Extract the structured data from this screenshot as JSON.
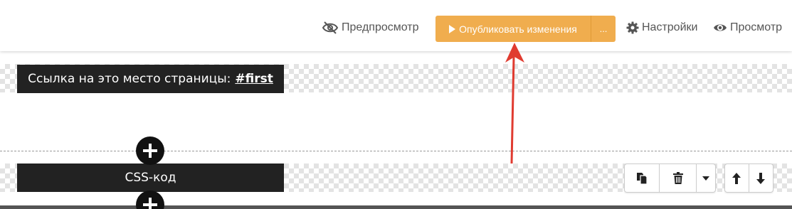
{
  "toolbar": {
    "preview_label": "Предпросмотр",
    "publish_label": "Опубликовать изменения",
    "publish_more_label": "...",
    "settings_label": "Настройки",
    "view_label": "Просмотр"
  },
  "blocks": [
    {
      "label_prefix": "Ссылка на это место страницы:",
      "anchor": "#first"
    },
    {
      "label": "CSS-код"
    }
  ],
  "colors": {
    "publish_button": "#f0ad4e",
    "block_label_bg": "#222222",
    "annotation_arrow": "#e03b30"
  },
  "icons": [
    "eye-slash-icon",
    "play-icon",
    "gear-icon",
    "eye-icon",
    "plus-icon",
    "copy-icon",
    "trash-icon",
    "caret-down-icon",
    "arrow-up-icon",
    "arrow-down-icon"
  ]
}
